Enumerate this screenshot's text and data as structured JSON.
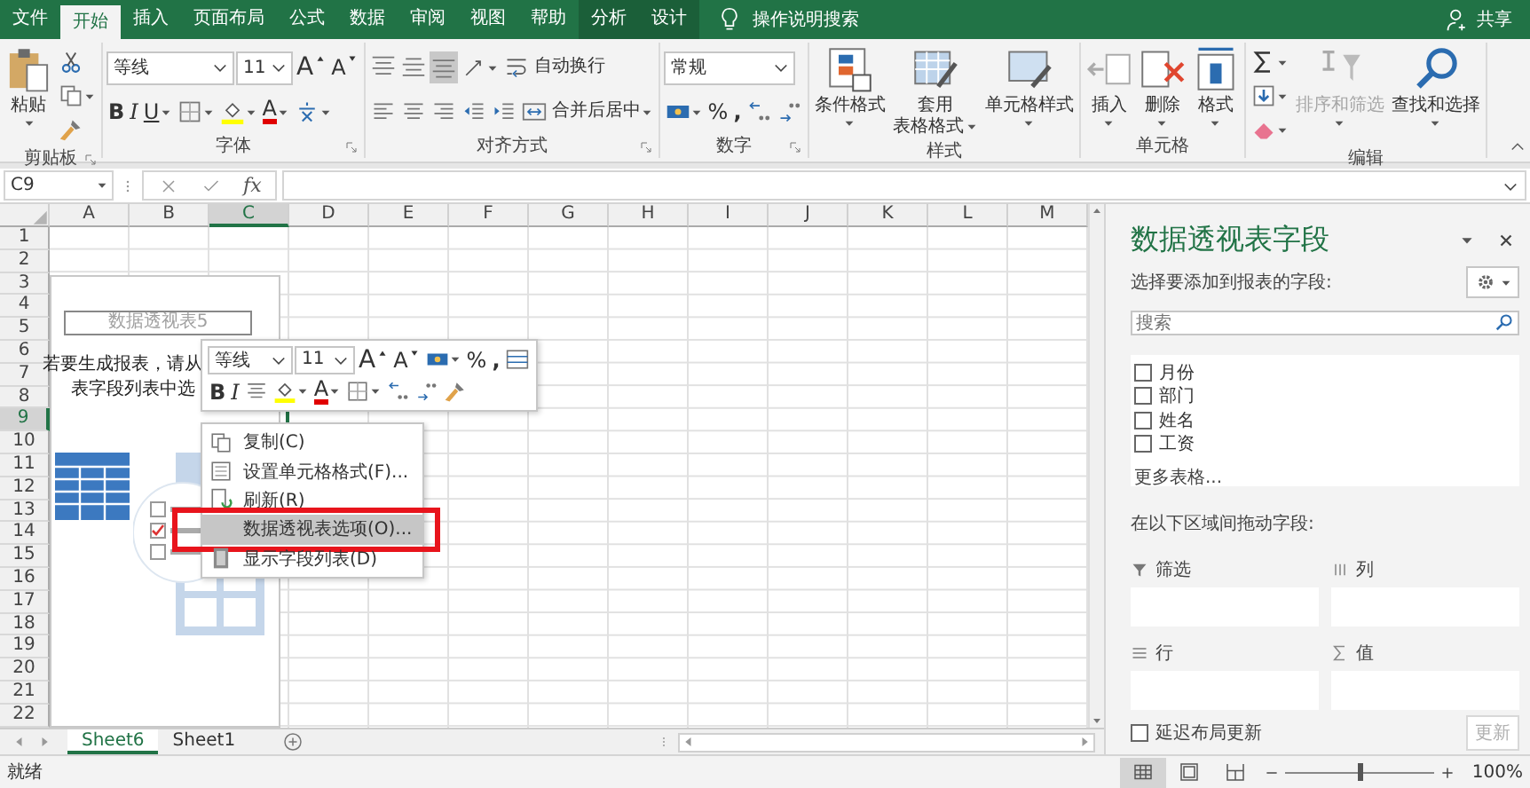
{
  "tabs": [
    {
      "label": "文件",
      "selected": false,
      "contextual": false
    },
    {
      "label": "开始",
      "selected": true,
      "contextual": false
    },
    {
      "label": "插入",
      "selected": false,
      "contextual": false
    },
    {
      "label": "页面布局",
      "selected": false,
      "contextual": false
    },
    {
      "label": "公式",
      "selected": false,
      "contextual": false
    },
    {
      "label": "数据",
      "selected": false,
      "contextual": false
    },
    {
      "label": "审阅",
      "selected": false,
      "contextual": false
    },
    {
      "label": "视图",
      "selected": false,
      "contextual": false
    },
    {
      "label": "帮助",
      "selected": false,
      "contextual": false
    },
    {
      "label": "分析",
      "selected": false,
      "contextual": true
    },
    {
      "label": "设计",
      "selected": false,
      "contextual": true
    }
  ],
  "tell_me": {
    "label": "操作说明搜索"
  },
  "share": {
    "label": "共享"
  },
  "ribbon": {
    "groups": [
      {
        "label": "剪贴板",
        "launcher": true,
        "items": [
          {
            "kind": "paste",
            "lines": [
              "粘贴"
            ],
            "dropdown": true
          },
          {
            "controls": [
              {
                "kind": "cut"
              },
              {
                "kind": "copy",
                "dropdown": true
              },
              {
                "kind": "format-painter"
              }
            ]
          }
        ]
      },
      {
        "label": "字体",
        "launcher": true,
        "items": [
          {
            "upper": [
              {
                "kind": "font-name",
                "value": "等线"
              },
              {
                "kind": "font-size",
                "value": "11"
              },
              {
                "kind": "grow-font",
                "label": "A"
              },
              {
                "kind": "shrink-font",
                "label": "A"
              }
            ],
            "lower": [
              {
                "kind": "bold",
                "label": "B"
              },
              {
                "kind": "italic",
                "label": "I"
              },
              {
                "kind": "underline",
                "label": "U",
                "dropdown": true
              },
              {
                "kind": "borders",
                "dropdown": true
              },
              {
                "kind": "fill-color",
                "dropdown": true
              },
              {
                "kind": "font-color",
                "label": "A",
                "dropdown": true
              },
              {
                "kind": "phonetic",
                "dropdown": true
              }
            ]
          }
        ]
      },
      {
        "label": "对齐方式",
        "launcher": true,
        "items": [
          {
            "upper": [
              {
                "kind": "align-top",
                "selected": false
              },
              {
                "kind": "align-middle",
                "selected": false
              },
              {
                "kind": "align-bottom",
                "selected": true
              },
              {
                "kind": "orientation",
                "dropdown": true
              },
              {
                "kind": "wrap-text",
                "label": "自动换行"
              }
            ],
            "lower": [
              {
                "kind": "align-left"
              },
              {
                "kind": "align-center"
              },
              {
                "kind": "align-right"
              },
              {
                "kind": "decrease-indent"
              },
              {
                "kind": "increase-indent"
              },
              {
                "kind": "merge-center",
                "label": "合并后居中",
                "dropdown": true
              }
            ]
          }
        ]
      },
      {
        "label": "数字",
        "launcher": true,
        "items": [
          {
            "upper": [
              {
                "kind": "number-format",
                "value": "常规"
              }
            ],
            "lower": [
              {
                "kind": "accounting",
                "dropdown": true
              },
              {
                "kind": "percent",
                "label": "%"
              },
              {
                "kind": "comma",
                "label": ","
              },
              {
                "kind": "increase-decimal"
              },
              {
                "kind": "decrease-decimal"
              }
            ]
          }
        ]
      },
      {
        "label": "样式",
        "launcher": false,
        "items": [
          {
            "kind": "conditional-format",
            "lines": [
              "条件格式"
            ],
            "dropdown": true
          },
          {
            "kind": "format-as-table",
            "lines": [
              "套用",
              "表格格式"
            ],
            "dropdown": true
          },
          {
            "kind": "cell-styles",
            "lines": [
              "单元格样式"
            ],
            "dropdown": true
          }
        ]
      },
      {
        "label": "单元格",
        "launcher": false,
        "items": [
          {
            "kind": "insert",
            "lines": [
              "插入"
            ],
            "dropdown": true
          },
          {
            "kind": "delete",
            "lines": [
              "删除"
            ],
            "dropdown": true
          },
          {
            "kind": "format",
            "lines": [
              "格式"
            ],
            "dropdown": true
          }
        ]
      },
      {
        "label": "编辑",
        "launcher": false,
        "items": [
          {
            "controls": [
              {
                "kind": "autosum",
                "dropdown": true
              },
              {
                "kind": "fill",
                "dropdown": true
              },
              {
                "kind": "clear",
                "dropdown": true
              }
            ]
          },
          {
            "kind": "sort-filter",
            "lines": [
              "排序和筛选"
            ],
            "dropdown": true,
            "disabled": true
          },
          {
            "kind": "find-select",
            "lines": [
              "查找和选择"
            ],
            "dropdown": true,
            "disabled": false
          }
        ]
      }
    ]
  },
  "formula_bar": {
    "name_box": "C9",
    "function_label": "fx"
  },
  "sheet": {
    "columns": [
      {
        "label": "A",
        "selected": false
      },
      {
        "label": "B",
        "selected": false
      },
      {
        "label": "C",
        "selected": true
      },
      {
        "label": "D",
        "selected": false
      },
      {
        "label": "E",
        "selected": false
      },
      {
        "label": "F",
        "selected": false
      },
      {
        "label": "G",
        "selected": false
      },
      {
        "label": "H",
        "selected": false
      },
      {
        "label": "I",
        "selected": false
      },
      {
        "label": "J",
        "selected": false
      },
      {
        "label": "K",
        "selected": false
      },
      {
        "label": "L",
        "selected": false
      },
      {
        "label": "M",
        "selected": false
      }
    ],
    "rows": [
      {
        "label": "1",
        "selected": false
      },
      {
        "label": "2",
        "selected": false
      },
      {
        "label": "3",
        "selected": false
      },
      {
        "label": "4",
        "selected": false
      },
      {
        "label": "5",
        "selected": false
      },
      {
        "label": "6",
        "selected": false
      },
      {
        "label": "7",
        "selected": false
      },
      {
        "label": "8",
        "selected": false
      },
      {
        "label": "9",
        "selected": true
      },
      {
        "label": "10",
        "selected": false
      },
      {
        "label": "11",
        "selected": false
      },
      {
        "label": "12",
        "selected": false
      },
      {
        "label": "13",
        "selected": false
      },
      {
        "label": "14",
        "selected": false
      },
      {
        "label": "15",
        "selected": false
      },
      {
        "label": "16",
        "selected": false
      },
      {
        "label": "17",
        "selected": false
      },
      {
        "label": "18",
        "selected": false
      },
      {
        "label": "19",
        "selected": false
      },
      {
        "label": "20",
        "selected": false
      },
      {
        "label": "21",
        "selected": false
      },
      {
        "label": "22",
        "selected": false
      }
    ]
  },
  "pivot_placeholder": {
    "title": "数据透视表5",
    "lines": [
      "若要生成报表，请从",
      "表字段列表中选"
    ]
  },
  "mini_toolbar": {
    "upper": [
      {
        "kind": "font-name",
        "value": "等线"
      },
      {
        "kind": "font-size",
        "value": "11"
      },
      {
        "kind": "grow-font",
        "label": "A"
      },
      {
        "kind": "shrink-font",
        "label": "A"
      },
      {
        "kind": "accounting",
        "dropdown": true
      },
      {
        "kind": "percent",
        "label": "%"
      },
      {
        "kind": "comma",
        "label": ","
      },
      {
        "kind": "format-table"
      }
    ],
    "lower": [
      {
        "kind": "bold",
        "label": "B"
      },
      {
        "kind": "italic",
        "label": "I"
      },
      {
        "kind": "align-center"
      },
      {
        "kind": "fill-color",
        "dropdown": true
      },
      {
        "kind": "font-color",
        "label": "A",
        "dropdown": true
      },
      {
        "kind": "borders",
        "dropdown": true
      },
      {
        "kind": "increase-decimal"
      },
      {
        "kind": "decrease-decimal"
      },
      {
        "kind": "format-painter"
      }
    ]
  },
  "context_menu": {
    "items": [
      {
        "kind": "copy",
        "label": "复制(C)",
        "selected": false
      },
      {
        "kind": "format-cells",
        "label": "设置单元格格式(F)...",
        "selected": false
      },
      {
        "kind": "refresh",
        "label": "刷新(R)",
        "selected": false
      },
      {
        "kind": "options",
        "label": "数据透视表选项(O)...",
        "selected": true
      },
      {
        "kind": "field-list",
        "label": "显示字段列表(D)",
        "selected": false
      }
    ]
  },
  "sheet_tabs": [
    {
      "label": "Sheet6",
      "selected": true
    },
    {
      "label": "Sheet1",
      "selected": false
    }
  ],
  "field_pane": {
    "title": "数据透视表字段",
    "subtitle": "选择要添加到报表的字段:",
    "search": {
      "placeholder": "搜索"
    },
    "fields": [
      {
        "label": "月份",
        "checked": false
      },
      {
        "label": "部门",
        "checked": false
      },
      {
        "label": "姓名",
        "checked": false
      },
      {
        "label": "工资",
        "checked": false
      }
    ],
    "more": "更多表格...",
    "areas_hint": "在以下区域间拖动字段:",
    "areas": [
      {
        "kind": "filter",
        "label": "筛选"
      },
      {
        "kind": "columns",
        "label": "列"
      },
      {
        "kind": "rows",
        "label": "行"
      },
      {
        "kind": "values",
        "label": "值"
      }
    ],
    "defer": {
      "label": "延迟布局更新",
      "checked": false
    },
    "update": {
      "label": "更新",
      "disabled": true
    }
  },
  "status_bar": {
    "status": "就绪",
    "views": [
      {
        "kind": "normal",
        "selected": true
      },
      {
        "kind": "page-layout",
        "selected": false
      },
      {
        "kind": "page-break",
        "selected": false
      }
    ],
    "zoom": {
      "level": 0.5,
      "reading": "100%"
    }
  }
}
